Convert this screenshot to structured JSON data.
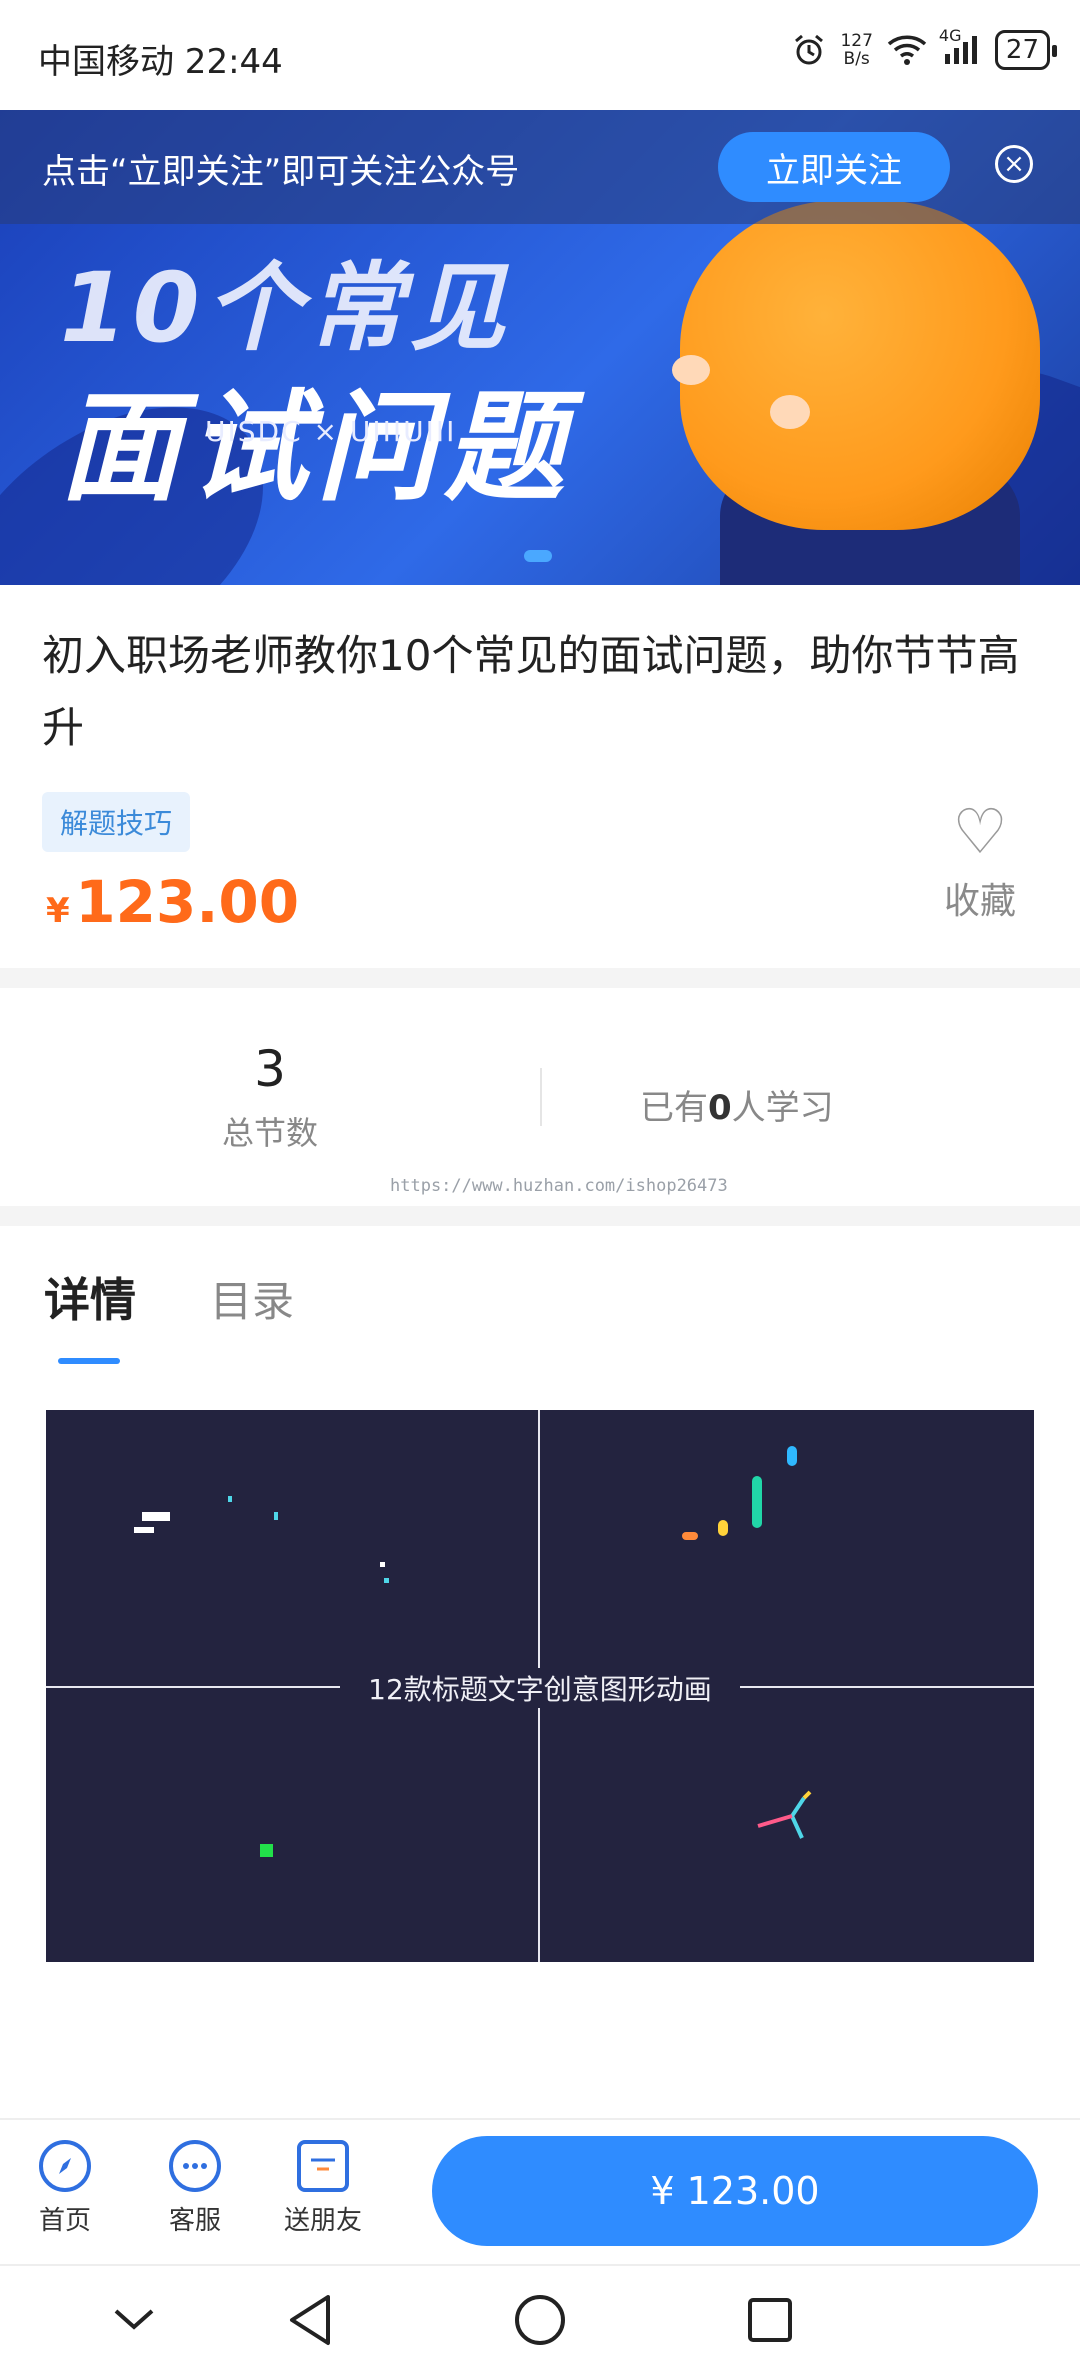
{
  "status_bar": {
    "carrier_time": "中国移动 22:44",
    "net_speed_value": "127",
    "net_speed_unit": "B/s",
    "signal_label": "4G",
    "battery": "27",
    "icons": [
      "alarm-icon",
      "wifi-icon",
      "signal-icon",
      "battery-icon"
    ]
  },
  "banner": {
    "headline_line1": "10个常见",
    "headline_line2": "面试问题",
    "brand": "UISDC × UIIIUIII",
    "follow_text": "点击“立即关注”即可关注公众号",
    "follow_button": "立即关注",
    "close_icon": "×"
  },
  "product": {
    "title": "初入职场老师教你10个常见的面试问题，助你节节高升",
    "tag": "解题技巧",
    "price_currency": "¥",
    "price_value": "123.00",
    "favorite_label": "收藏",
    "favorite_icon": "♡"
  },
  "stats": {
    "sections_count": "3",
    "sections_label": "总节数",
    "learners_prefix": "已有",
    "learners_count": "0",
    "learners_suffix": "人学习"
  },
  "watermark": "https://www.huzhan.com/ishop26473",
  "tabs": {
    "detail": "详情",
    "catalog": "目录"
  },
  "video": {
    "title": "12款标题文字创意图形动画"
  },
  "bottom_nav": {
    "home": "首页",
    "service": "客服",
    "gift": "送朋友",
    "buy_button": "¥ 123.00"
  },
  "colors": {
    "accent": "#2f8cff",
    "price": "#ff6a1a",
    "video_bg": "#23233f"
  }
}
